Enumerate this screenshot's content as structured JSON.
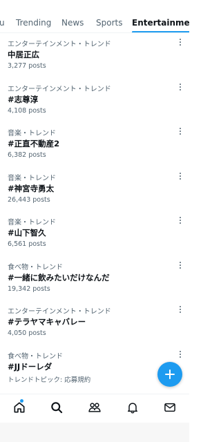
{
  "tabs": [
    {
      "label": "u",
      "active": false
    },
    {
      "label": "Trending",
      "active": false
    },
    {
      "label": "News",
      "active": false
    },
    {
      "label": "Sports",
      "active": false
    },
    {
      "label": "Entertainment",
      "active": true
    }
  ],
  "trends": [
    {
      "category": "エンターテインメント・トレンド",
      "name": "中居正広",
      "count": "3,277 posts"
    },
    {
      "category": "エンターテインメント・トレンド",
      "name": "#志尊淳",
      "count": "4,108 posts"
    },
    {
      "category": "音楽・トレンド",
      "name": "#正直不動産2",
      "count": "6,382 posts"
    },
    {
      "category": "音楽・トレンド",
      "name": "#神宮寺勇太",
      "count": "26,443 posts"
    },
    {
      "category": "音楽・トレンド",
      "name": "#山下智久",
      "count": "6,561 posts"
    },
    {
      "category": "食べ物・トレンド",
      "name": "#一緒に飲みたいだけなんだ",
      "count": "19,342 posts"
    },
    {
      "category": "エンターテインメント・トレンド",
      "name": "#テラヤマキャバレー",
      "count": "4,050 posts"
    },
    {
      "category": "食べ物・トレンド",
      "name": "#JJドーレダ",
      "count": "トレンドトピック: 応募規約"
    }
  ],
  "fab": {
    "icon": "plus-icon"
  },
  "bottom_nav": [
    {
      "icon": "home-icon",
      "has_dot": true
    },
    {
      "icon": "search-icon",
      "has_dot": false
    },
    {
      "icon": "communities-icon",
      "has_dot": false
    },
    {
      "icon": "bell-icon",
      "has_dot": false
    },
    {
      "icon": "mail-icon",
      "has_dot": false
    }
  ],
  "colors": {
    "accent": "#1d9bf0",
    "text_primary": "#0f1419",
    "text_secondary": "#536471",
    "divider": "#eff3f4"
  }
}
